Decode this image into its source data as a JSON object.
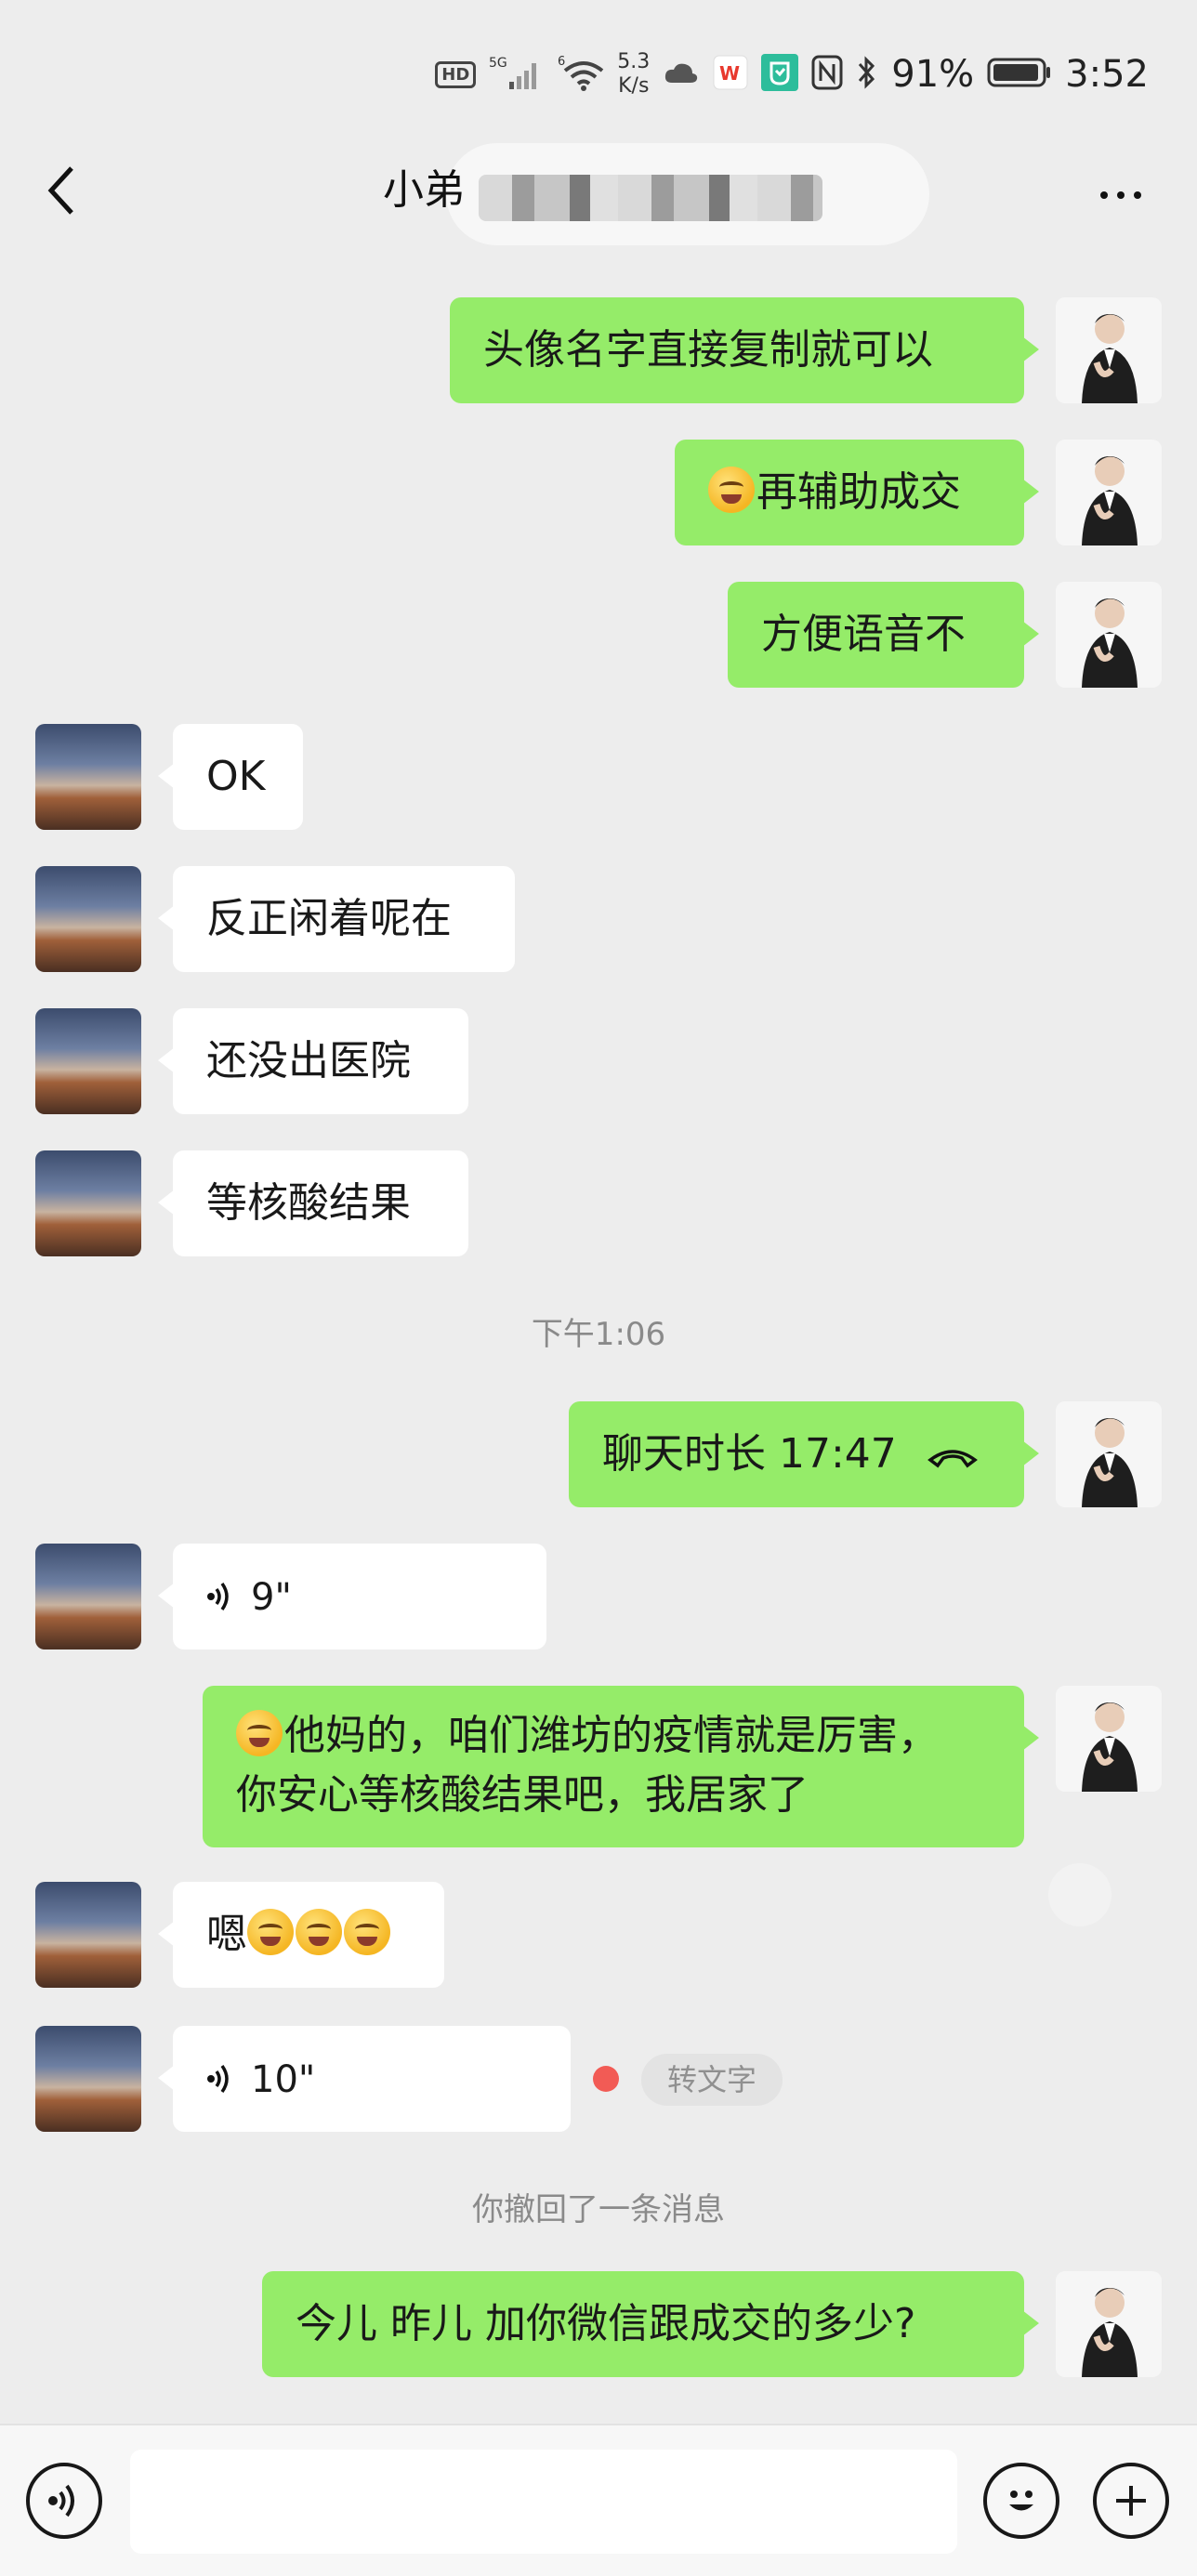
{
  "status_bar": {
    "network_badge": "HD",
    "net_5g": "5G",
    "net_6": "6",
    "speed_value": "5.3",
    "speed_unit": "K/s",
    "battery": "91%",
    "time": "3:52",
    "icons": [
      "signal-icon",
      "wifi-icon",
      "cloud-icon",
      "wps-icon",
      "mi-icon",
      "nfc-icon",
      "bluetooth-icon",
      "battery-icon"
    ]
  },
  "header": {
    "title": "小弟",
    "back_icon": "chevron-left-icon",
    "more_icon": "more-dots-icon"
  },
  "messages": [
    {
      "side": "me",
      "text": "头像名字直接复制就可以"
    },
    {
      "side": "me",
      "text": "再辅助成交",
      "emoji_prefix": true
    },
    {
      "side": "me",
      "text": "方便语音不"
    },
    {
      "side": "other",
      "text": "OK"
    },
    {
      "side": "other",
      "text": "反正闲着呢在"
    },
    {
      "side": "other",
      "text": "还没出医院"
    },
    {
      "side": "other",
      "text": "等核酸结果"
    },
    {
      "type": "time",
      "text": "下午1:06"
    },
    {
      "side": "me",
      "type": "call",
      "text": "聊天时长 17:47"
    },
    {
      "side": "other",
      "type": "voice",
      "text": "9\""
    },
    {
      "side": "me",
      "line1": "他妈的，咱们潍坊的疫情就是厉害，",
      "line2": "你安心等核酸结果吧，我居家了",
      "emoji_prefix": true
    },
    {
      "side": "other",
      "text": "嗯",
      "emoji_suffix_count": 3
    },
    {
      "side": "other",
      "type": "voice",
      "text": "10\"",
      "convert_label": "转文字"
    },
    {
      "type": "system",
      "text": "你撤回了一条消息"
    },
    {
      "side": "me",
      "text": "今儿 昨儿 加你微信跟成交的多少?"
    }
  ],
  "input_bar": {
    "voice_icon": "voice-toggle-icon",
    "emoji_icon": "emoji-icon",
    "plus_icon": "plus-icon",
    "placeholder": ""
  },
  "colors": {
    "background": "#ededed",
    "bubble_me": "#95ec69",
    "bubble_other": "#ffffff",
    "unread_dot": "#f25b55"
  }
}
